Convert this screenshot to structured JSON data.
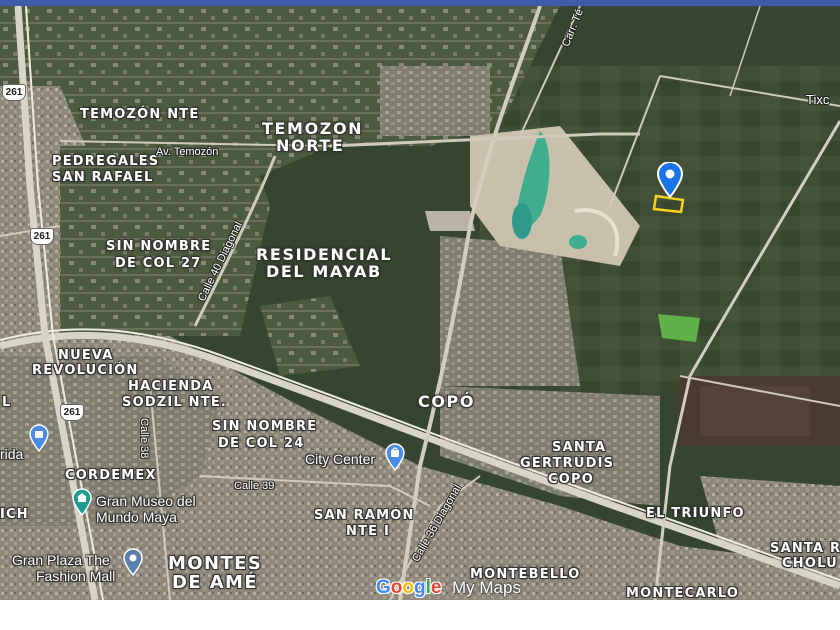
{
  "map": {
    "type": "satellite",
    "colors": {
      "vegetation": "#3a4a33",
      "urban": "#9a9487",
      "road": "#d9d4c8",
      "accent_pin": "#1a73e8",
      "property_outline": "#f2d21b",
      "lagoon": "#3fae8e"
    },
    "neighborhood_labels": [
      {
        "text": "TEMOZÓN NTE",
        "size": "normal"
      },
      {
        "text": "TEMOZON",
        "size": "big"
      },
      {
        "text": "NORTE",
        "size": "big"
      },
      {
        "text": "PEDREGALES",
        "size": "normal"
      },
      {
        "text": "SAN RAFAEL",
        "size": "normal"
      },
      {
        "text": "SIN NOMBRE",
        "size": "normal"
      },
      {
        "text": "DE COL 27",
        "size": "normal"
      },
      {
        "text": "RESIDENCIAL",
        "size": "big"
      },
      {
        "text": "DEL MAYAB",
        "size": "big"
      },
      {
        "text": "NUEVA",
        "size": "normal"
      },
      {
        "text": "REVOLUCIÓN",
        "size": "normal"
      },
      {
        "text": "HACIENDA",
        "size": "normal"
      },
      {
        "text": "SODZIL NTE.",
        "size": "normal"
      },
      {
        "text": "SIN NOMBRE",
        "size": "normal"
      },
      {
        "text": "DE COL 24",
        "size": "normal"
      },
      {
        "text": "COPÓ",
        "size": "big"
      },
      {
        "text": "SANTA",
        "size": "normal"
      },
      {
        "text": "GERTRUDIS",
        "size": "normal"
      },
      {
        "text": "COPO",
        "size": "normal"
      },
      {
        "text": "CORDEMEX",
        "size": "normal"
      },
      {
        "text": "SAN RAMÓN",
        "size": "normal"
      },
      {
        "text": "NTE I",
        "size": "normal"
      },
      {
        "text": "EL TRIUNFO",
        "size": "normal"
      },
      {
        "text": "MONTES",
        "size": "xl"
      },
      {
        "text": "DE AMÉ",
        "size": "xl"
      },
      {
        "text": "MONTEBELLO",
        "size": "normal"
      },
      {
        "text": "MONTECARLO",
        "size": "normal"
      },
      {
        "text": "SANTA R",
        "size": "normal"
      },
      {
        "text": "CHOLU",
        "size": "normal"
      },
      {
        "text": "ICH",
        "size": "normal"
      },
      {
        "text": "L",
        "size": "normal"
      }
    ],
    "street_labels": [
      "Av. Temozón",
      "Calle 40 Diagonal",
      "Calle 38",
      "Calle 39",
      "Calle 36 Diagonal",
      "Carr. Té",
      "Tixc"
    ],
    "highway_shields": [
      "261",
      "261",
      "261"
    ],
    "places": [
      {
        "name": "City Center",
        "icon": "shopping-bag-pin-icon"
      },
      {
        "name": "Gran Museo del",
        "icon": "museum-pin-icon"
      },
      {
        "name": "Mundo Maya",
        "icon": ""
      },
      {
        "name": "Gran Plaza The",
        "icon": "mall-pin-icon"
      },
      {
        "name": "Fashion Mall",
        "icon": ""
      },
      {
        "name": "rida",
        "icon": "shopping-bag-pin-icon"
      }
    ],
    "property_marker": {
      "icon": "location-pin-icon",
      "outline": "yellow-parcel-outline"
    },
    "attribution": {
      "logo": "Google",
      "product": "My Maps"
    }
  }
}
